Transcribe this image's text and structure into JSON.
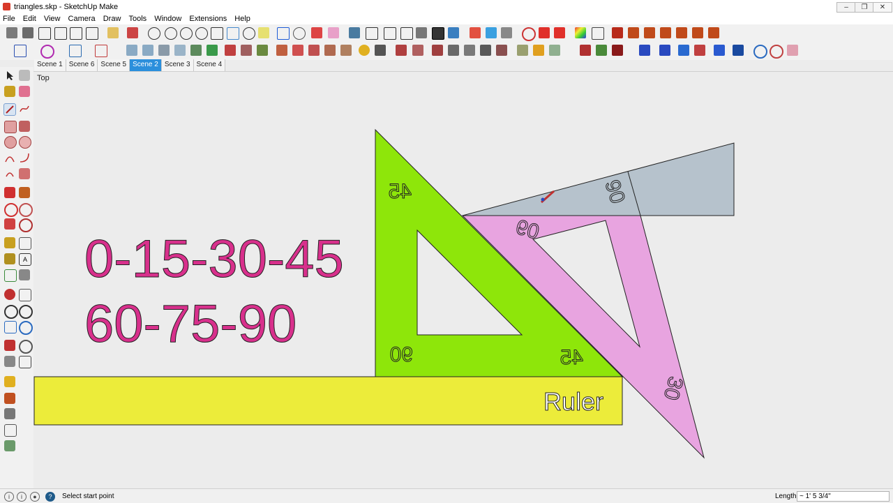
{
  "window": {
    "title": "triangles.skp - SketchUp Make"
  },
  "menu": [
    "File",
    "Edit",
    "View",
    "Camera",
    "Draw",
    "Tools",
    "Window",
    "Extensions",
    "Help"
  ],
  "scenes": [
    {
      "label": "Scene 1",
      "active": false
    },
    {
      "label": "Scene 6",
      "active": false
    },
    {
      "label": "Scene 5",
      "active": false
    },
    {
      "label": "Scene 2",
      "active": true
    },
    {
      "label": "Scene 3",
      "active": false
    },
    {
      "label": "Scene 4",
      "active": false
    }
  ],
  "viewport": {
    "view_name": "Top"
  },
  "canvas": {
    "angles_line1": "0-15-30-45",
    "angles_line2": "60-75-90",
    "green_triangle_labels": [
      "45",
      "90",
      "45"
    ],
    "pink_triangle_labels": [
      "60",
      "30"
    ],
    "gray_triangle_label": "90",
    "ruler_label": "Ruler"
  },
  "colors": {
    "angle_text": "#d8308c",
    "green_set_square": "#8ee60a",
    "pink_set_square": "#e8a4e0",
    "gray_set_square": "#b6c2cc",
    "ruler": "#ecec3a",
    "scene_tab_active": "#2b8fdc"
  },
  "status": {
    "message": "Select start point",
    "measure_label": "Length",
    "measure_value": "~ 1' 5 3/4\""
  }
}
